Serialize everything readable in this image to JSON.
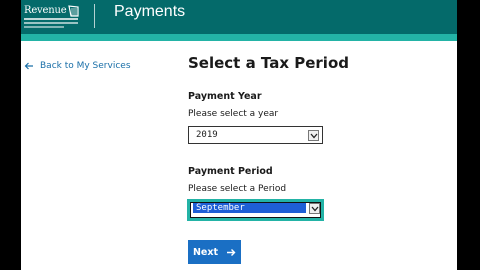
{
  "header": {
    "logo_text": "Revenue",
    "title": "Payments"
  },
  "nav": {
    "back_label": "Back to My Services"
  },
  "main": {
    "title": "Select a Tax Period",
    "payment_year": {
      "label": "Payment Year",
      "hint": "Please select a year",
      "value": "2019"
    },
    "payment_period": {
      "label": "Payment Period",
      "hint": "Please select a Period",
      "value": "September"
    },
    "next_label": "Next"
  },
  "colors": {
    "header_bg": "#046a6a",
    "header_stripe": "#23b3a6",
    "link": "#1a6fa8",
    "button": "#1a6fc4",
    "selection": "#1e5fd6"
  },
  "icons": [
    "harp-logo-icon",
    "arrow-left-icon",
    "chevron-down-icon",
    "arrow-right-icon"
  ]
}
